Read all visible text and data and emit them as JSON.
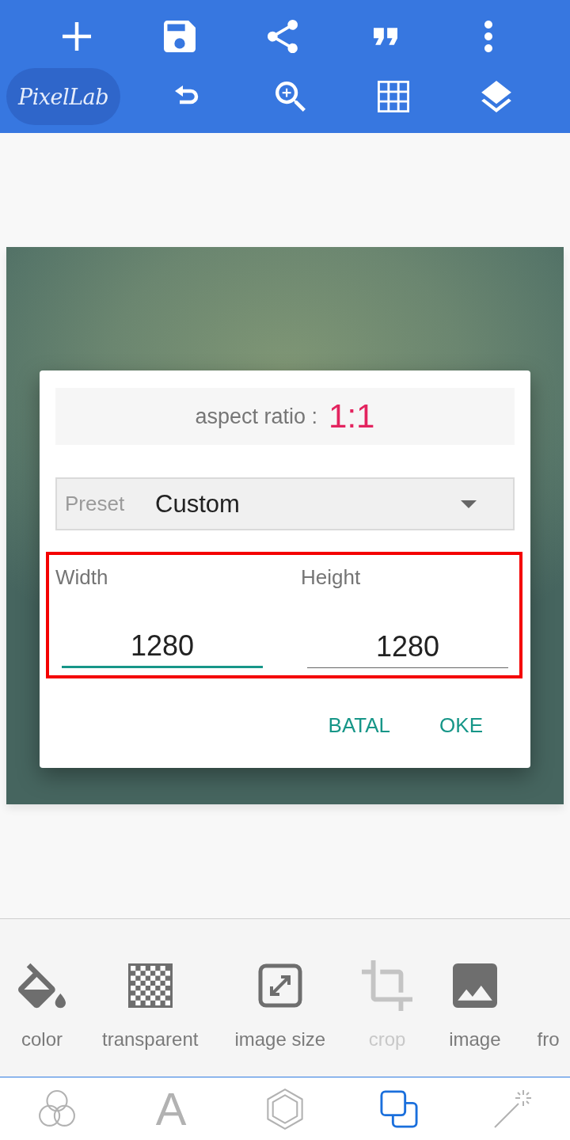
{
  "toolbar": {
    "logo": "PixelLab"
  },
  "dialog": {
    "aspect_ratio": {
      "label": "aspect ratio :",
      "value": "1:1"
    },
    "preset": {
      "label": "Preset",
      "value": "Custom"
    },
    "size_fields": [
      {
        "label": "Width",
        "value": "1280",
        "focused": true
      },
      {
        "label": "Height",
        "value": "1280",
        "focused": false
      }
    ],
    "buttons": [
      "BATAL",
      "OKE"
    ]
  },
  "tools": [
    {
      "label": "color",
      "disabled": false
    },
    {
      "label": "transparent",
      "disabled": false
    },
    {
      "label": "image size",
      "disabled": false
    },
    {
      "label": "crop",
      "disabled": true
    },
    {
      "label": "image",
      "disabled": false
    },
    {
      "label": "fro",
      "disabled": false
    }
  ],
  "bottom_tabs": [
    {
      "selected": false
    },
    {
      "glyph": "A",
      "selected": false
    },
    {
      "selected": false
    },
    {
      "selected": true
    },
    {
      "selected": false
    }
  ]
}
